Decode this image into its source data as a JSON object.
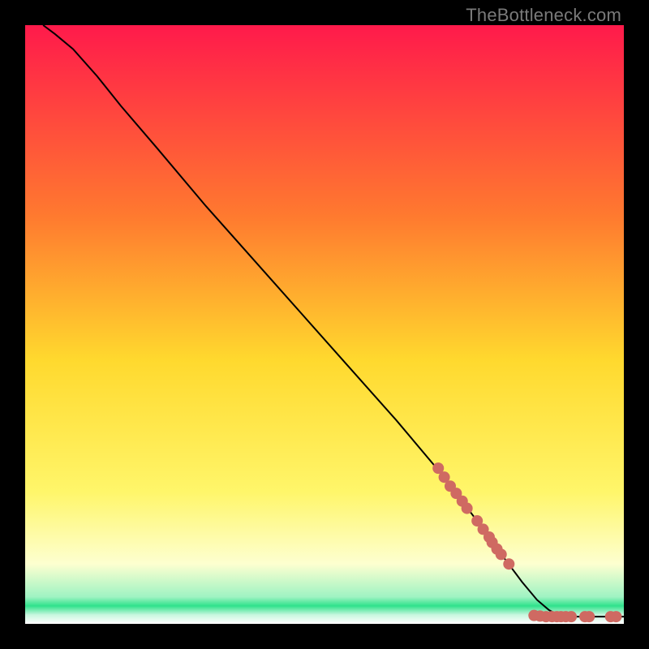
{
  "attribution": "TheBottleneck.com",
  "colors": {
    "page_bg": "#000000",
    "grad_top": "#ff1a4b",
    "grad_mid_upper": "#ff7a2f",
    "grad_mid": "#ffd92e",
    "grad_lower": "#fff66a",
    "grad_pale": "#fdffd0",
    "grad_green": "#2fe28b",
    "curve": "#000000",
    "marker_fill": "#cf6a62",
    "marker_stroke": "#cf6a62",
    "attribution_text": "#7a7a7a"
  },
  "chart_data": {
    "type": "line",
    "title": "",
    "xlabel": "",
    "ylabel": "",
    "x_range": [
      0,
      100
    ],
    "y_range": [
      0,
      100
    ],
    "gradient_stops": [
      {
        "pos": 0.0,
        "color": "#ff1a4b"
      },
      {
        "pos": 0.32,
        "color": "#ff7a2f"
      },
      {
        "pos": 0.56,
        "color": "#ffd92e"
      },
      {
        "pos": 0.78,
        "color": "#fff66a"
      },
      {
        "pos": 0.9,
        "color": "#fdffd0"
      },
      {
        "pos": 0.955,
        "color": "#9ff3c3"
      },
      {
        "pos": 0.97,
        "color": "#2fe28b"
      },
      {
        "pos": 0.985,
        "color": "#c8f7df"
      },
      {
        "pos": 1.0,
        "color": "#ffffff"
      }
    ],
    "curve": [
      {
        "x": 3.0,
        "y": 100.0
      },
      {
        "x": 5.0,
        "y": 98.5
      },
      {
        "x": 8.0,
        "y": 96.0
      },
      {
        "x": 12.0,
        "y": 91.5
      },
      {
        "x": 16.0,
        "y": 86.5
      },
      {
        "x": 22.0,
        "y": 79.5
      },
      {
        "x": 30.0,
        "y": 70.0
      },
      {
        "x": 38.0,
        "y": 61.0
      },
      {
        "x": 46.0,
        "y": 52.0
      },
      {
        "x": 54.0,
        "y": 43.0
      },
      {
        "x": 62.0,
        "y": 34.0
      },
      {
        "x": 70.0,
        "y": 24.5
      },
      {
        "x": 76.0,
        "y": 16.5
      },
      {
        "x": 80.0,
        "y": 11.0
      },
      {
        "x": 83.0,
        "y": 7.0
      },
      {
        "x": 85.5,
        "y": 4.0
      },
      {
        "x": 87.5,
        "y": 2.3
      },
      {
        "x": 89.0,
        "y": 1.5
      },
      {
        "x": 91.0,
        "y": 1.2
      },
      {
        "x": 94.0,
        "y": 1.2
      },
      {
        "x": 97.0,
        "y": 1.2
      },
      {
        "x": 100.0,
        "y": 1.2
      }
    ],
    "markers": [
      {
        "x": 69.0,
        "y": 26.0
      },
      {
        "x": 70.0,
        "y": 24.5
      },
      {
        "x": 71.0,
        "y": 23.0
      },
      {
        "x": 72.0,
        "y": 21.8
      },
      {
        "x": 73.0,
        "y": 20.5
      },
      {
        "x": 73.8,
        "y": 19.3
      },
      {
        "x": 75.5,
        "y": 17.2
      },
      {
        "x": 76.5,
        "y": 15.8
      },
      {
        "x": 77.5,
        "y": 14.5
      },
      {
        "x": 78.0,
        "y": 13.6
      },
      {
        "x": 78.8,
        "y": 12.5
      },
      {
        "x": 79.5,
        "y": 11.6
      },
      {
        "x": 80.8,
        "y": 10.0
      },
      {
        "x": 85.0,
        "y": 1.4
      },
      {
        "x": 86.0,
        "y": 1.3
      },
      {
        "x": 87.0,
        "y": 1.2
      },
      {
        "x": 88.0,
        "y": 1.2
      },
      {
        "x": 88.8,
        "y": 1.2
      },
      {
        "x": 89.5,
        "y": 1.2
      },
      {
        "x": 90.3,
        "y": 1.2
      },
      {
        "x": 91.2,
        "y": 1.2
      },
      {
        "x": 93.5,
        "y": 1.2
      },
      {
        "x": 94.2,
        "y": 1.2
      },
      {
        "x": 97.8,
        "y": 1.2
      },
      {
        "x": 98.7,
        "y": 1.2
      }
    ],
    "marker_radius_data_units": 0.95
  }
}
